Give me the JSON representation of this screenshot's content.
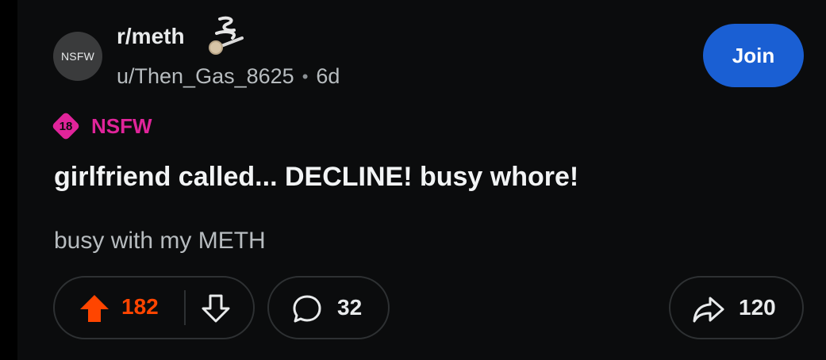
{
  "post": {
    "subreddit": {
      "name": "r/meth",
      "avatar_label": "NSFW",
      "icon": "pipe-smoke-icon"
    },
    "author": "u/Then_Gas_8625",
    "separator": "•",
    "age": "6d",
    "join_label": "Join",
    "nsfw": {
      "badge_text": "18",
      "label": "NSFW",
      "color": "#e0249a"
    },
    "title": "girlfriend called... DECLINE! busy whore!",
    "body": "busy with my METH"
  },
  "actions": {
    "upvote_icon": "upvote-arrow-icon",
    "vote_count": "182",
    "downvote_icon": "downvote-arrow-icon",
    "comment_icon": "comment-bubble-icon",
    "comment_count": "32",
    "share_icon": "share-arrow-icon",
    "share_count": "120"
  },
  "colors": {
    "background": "#0b0c0d",
    "accent_join": "#1a5fd3",
    "upvote_active": "#ff4500",
    "text_primary": "#f2f4f5",
    "text_secondary": "#b7bcbf",
    "pill_border": "#2e3133"
  }
}
